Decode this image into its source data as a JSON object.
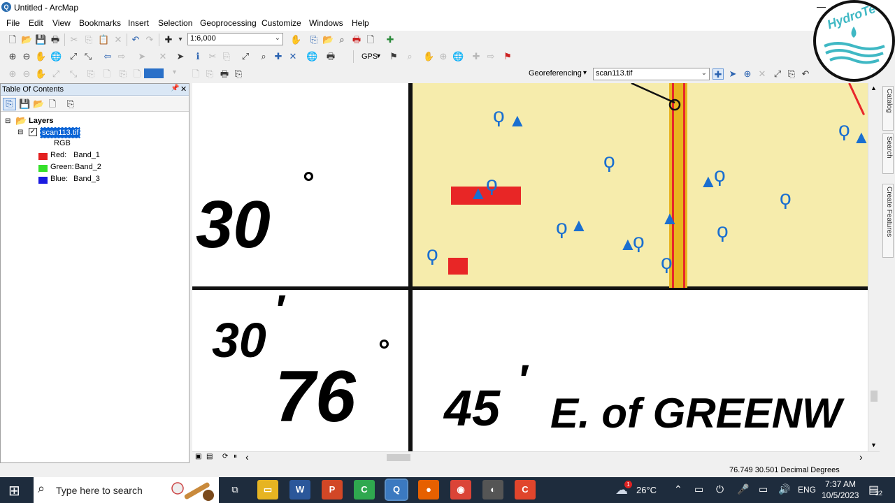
{
  "window": {
    "title": "Untitled - ArcMap",
    "app_icon_glyph": "Q",
    "minimize_glyph": "—"
  },
  "menu": [
    "File",
    "Edit",
    "View",
    "Bookmarks",
    "Insert",
    "Selection",
    "Geoprocessing",
    "Customize",
    "Windows",
    "Help"
  ],
  "toolbar": {
    "scale_value": "1:6,000",
    "gps_label": "GPS",
    "georef_label": "Georeferencing",
    "georef_layer": "scan113.tif",
    "dropdown_glyph": "▾",
    "combo_arrow": "⌄"
  },
  "toc": {
    "title": "Table Of Contents",
    "pin_glyph": "📌",
    "close_glyph": "✕",
    "root_label": "Layers",
    "layer_label": "scan113.tif",
    "layer_checked": true,
    "collapse_glyph": "⊟",
    "check_glyph": "✓",
    "composite_label": "RGB",
    "bands": [
      {
        "channel": "Red:",
        "band": "Band_1",
        "color": "#e32020"
      },
      {
        "channel": "Green:",
        "band": "Band_2",
        "color": "#35e02a"
      },
      {
        "channel": "Blue:",
        "band": "Band_3",
        "color": "#1a1ae0"
      }
    ]
  },
  "map": {
    "lat_deg": "30",
    "lat_min": "30",
    "lon_deg": "76",
    "lon_min": "45",
    "lon_text": "E. of GREENW",
    "degree_sign": "°",
    "minute_sign": "′",
    "map_fill": "#f6ecac",
    "tree_symbol": "ϙ",
    "tent_symbol": "▲"
  },
  "dock_tabs": [
    "Catalog",
    "Search",
    "Create Features"
  ],
  "statusbar": {
    "coordinates": "76.749  30.501 Decimal Degrees"
  },
  "scrollbar": {
    "up": "▲",
    "down": "▼",
    "left": "‹",
    "right": "›",
    "view_buttons": [
      "▣",
      "▤",
      "⟳",
      "⏸"
    ]
  },
  "logo": {
    "text": "HydroTech"
  },
  "taskbar": {
    "start_glyph": "⊞",
    "search_glyph": "⌕",
    "search_placeholder": "Type here to search",
    "apps": [
      {
        "glyph": "⧉",
        "name": "task-view",
        "bg": "transparent"
      },
      {
        "glyph": "▭",
        "name": "file-explorer",
        "bg": "#e6b422"
      },
      {
        "glyph": "W",
        "name": "word",
        "bg": "#2b579a"
      },
      {
        "glyph": "P",
        "name": "powerpoint",
        "bg": "#d24726"
      },
      {
        "glyph": "C",
        "name": "camtasia",
        "bg": "#2fa84f"
      },
      {
        "glyph": "Q",
        "name": "arcmap",
        "bg": "#3b79c0"
      },
      {
        "glyph": "●",
        "name": "firefox",
        "bg": "#e66000"
      },
      {
        "glyph": "◉",
        "name": "chrome",
        "bg": "#db4437"
      },
      {
        "glyph": "◐",
        "name": "vpn-app",
        "bg": "#555"
      },
      {
        "glyph": "C",
        "name": "recorder",
        "bg": "#e0452c"
      }
    ],
    "weather_glyph": "☁",
    "weather_badge": "1",
    "temperature": "26°C",
    "tray_glyphs": [
      "⌃",
      "▭",
      "⏻",
      "⎙",
      "🎤",
      "▭",
      "🔊"
    ],
    "language": "ENG",
    "time": "7:37 AM",
    "date": "10/5/2023",
    "notification_glyph": "▤",
    "notification_count": "22"
  },
  "icons": {
    "new": "🗋",
    "open": "📂",
    "save": "💾",
    "print": "🖶",
    "cut": "✂",
    "copy": "⎘",
    "paste": "📋",
    "delete": "✕",
    "undo": "↶",
    "redo": "↷",
    "add_data": "✚",
    "zoom_in": "⊕",
    "zoom_out": "⊖",
    "pan": "✋",
    "full_extent": "🌐",
    "fixed_zoom_in": "⤢",
    "fixed_zoom_out": "⤡",
    "back": "⇦",
    "forward": "⇨",
    "select": "➤",
    "identify": "ℹ",
    "find": "⌕",
    "flag": "⚑"
  }
}
